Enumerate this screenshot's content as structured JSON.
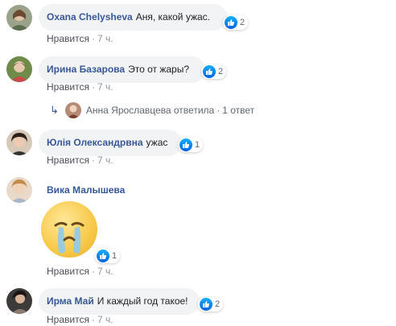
{
  "comments": [
    {
      "name": "Oxana Chelysheva",
      "text": "Аня, какой ужас.",
      "reactions": "2",
      "like": "Нравится",
      "dot": "·",
      "time": "7 ч."
    },
    {
      "name": "Ирина Базарова",
      "text": "Это от жары?",
      "reactions": "2",
      "like": "Нравится",
      "dot": "·",
      "time": "7 ч.",
      "reply": {
        "author_action": "Анна Ярославцева ответила",
        "dot": "·",
        "count": "1 ответ"
      }
    },
    {
      "name": "Юлія Олександрвна",
      "text": "ужас",
      "reactions": "1",
      "like": "Нравится",
      "dot": "·",
      "time": "7 ч."
    },
    {
      "name": "Вика Малышева",
      "text": "",
      "reactions": "1",
      "like": "Нравится",
      "dot": "·",
      "time": "7 ч."
    },
    {
      "name": "Ирма Май",
      "text": "И каждый год такое!",
      "reactions": "2",
      "like": "Нравится",
      "dot": "·",
      "time": "7 ч."
    }
  ],
  "colors": {
    "name": "#385898",
    "bubble": "#f2f3f5",
    "like_blue": "#1877f2",
    "meta": "#90949c"
  },
  "icons": {
    "like": "thumbs-up-icon",
    "reply": "reply-arrow-icon",
    "sticker": "crying-face-sticker"
  }
}
